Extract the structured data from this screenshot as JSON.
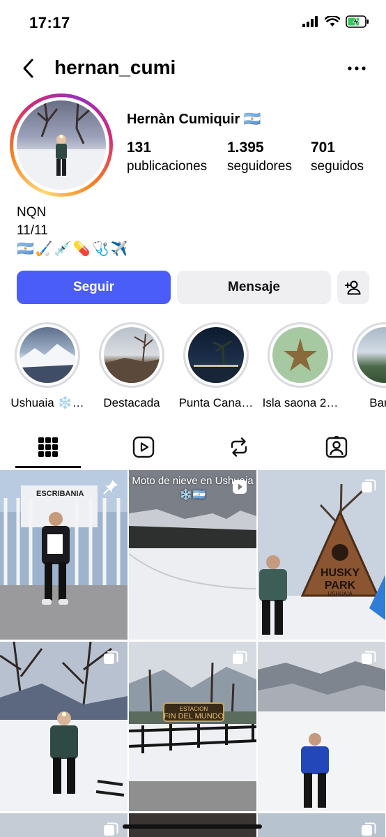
{
  "status": {
    "time": "17:17"
  },
  "header": {
    "username": "hernan_cumi"
  },
  "profile": {
    "name": "Hernàn Cumiquir 🇦🇷",
    "stats": [
      {
        "value": "131",
        "label": "publicaciones"
      },
      {
        "value": "1.395",
        "label": "seguidores"
      },
      {
        "value": "701",
        "label": "seguidos"
      }
    ],
    "bio": [
      "NQN",
      "11/11",
      "🇦🇷🏑💉💊🩺✈️"
    ]
  },
  "actions": {
    "follow": "Seguir",
    "message": "Mensaje"
  },
  "highlights": [
    "Ushuaia ❄️…",
    "Destacada",
    "Punta Cana…",
    "Isla saona 2…",
    "Barilo"
  ],
  "tabs": [
    "grid-icon",
    "reels-icon",
    "reposts-icon",
    "tagged-icon"
  ],
  "posts": [
    {
      "badge": "pin-icon",
      "overlay": ""
    },
    {
      "badge": "reel-icon",
      "overlay": "Moto de nieve en Ushuaia ❄️🇦🇷"
    },
    {
      "badge": "carousel-icon",
      "overlay": ""
    },
    {
      "badge": "carousel-icon",
      "overlay": ""
    },
    {
      "badge": "carousel-icon",
      "overlay": ""
    },
    {
      "badge": "carousel-icon",
      "overlay": ""
    }
  ],
  "photo_text": {
    "p1_sign": "ESCRIBANIA",
    "p3_sign_1": "HUSKY",
    "p3_sign_2": "PARK",
    "p3_sign_3": "USHUAIA",
    "p5_sign_1": "ESTACION",
    "p5_sign_2": "FIN DEL MUNDO"
  },
  "colors": {
    "follow_button": "#4a5df9",
    "secondary_button": "#efeff2"
  }
}
